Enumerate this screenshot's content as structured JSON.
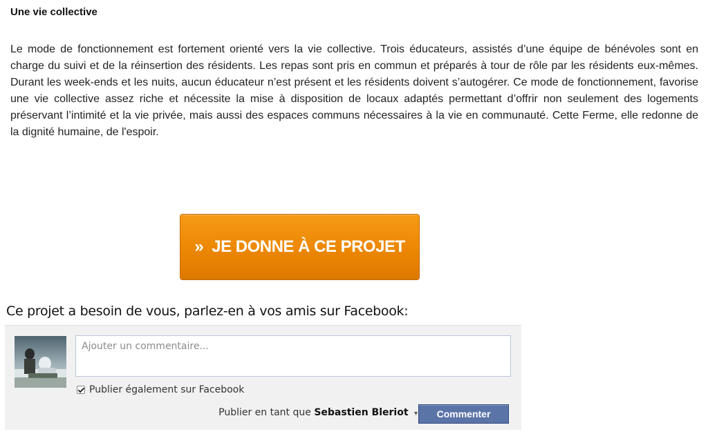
{
  "section": {
    "title": "Une vie collective",
    "paragraph": "Le mode de fonctionnement est fortement orienté vers la vie collective. Trois éducateurs, assistés d’une équipe de bénévoles sont en charge du suivi et de la réinsertion des résidents. Les repas sont pris en commun et préparés à tour de rôle par les résidents eux-mêmes. Durant les week-ends et les nuits, aucun éducateur n’est présent et les résidents doivent s’autogérer. Ce mode de fonctionnement, favorise une vie collective assez riche et nécessite la mise à disposition de locaux adaptés permettant d’offrir non seulement des logements préservant l’intimité et la vie privée, mais aussi des espaces communs nécessaires à la vie en communauté. Cette Ferme, elle redonne de la dignité humaine, de l'espoir."
  },
  "donate": {
    "chevron": "»",
    "label": "JE DONNE À CE PROJET",
    "color": "#ec8703"
  },
  "share": {
    "heading": "Ce projet a besoin de vous, parlez-en à vos amis sur Facebook:"
  },
  "facebook": {
    "comment_placeholder": "Ajouter un commentaire...",
    "publish_checkbox_label": "Publier également sur Facebook",
    "publish_checked": true,
    "post_as_prefix": "Publier en tant que",
    "user_name": "Sebastien Bleriot",
    "caret": "▾",
    "comment_button": "Commenter",
    "button_color": "#5b74a8"
  }
}
